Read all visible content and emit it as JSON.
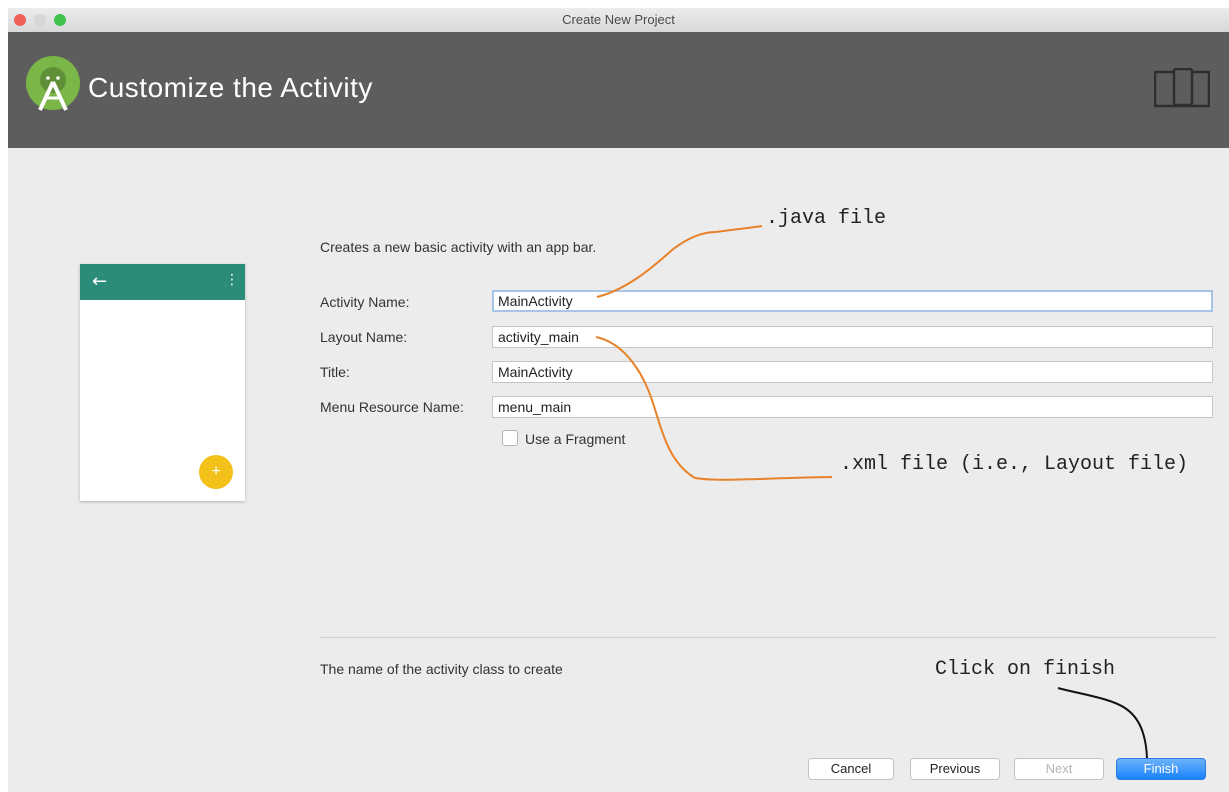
{
  "window": {
    "title": "Create New Project"
  },
  "header": {
    "title": "Customize the Activity",
    "logo_icon": "android-studio-logo-icon",
    "device_icon": "device-layout-icon"
  },
  "preview": {
    "back_icon": "←",
    "menu_icon": "⋮",
    "fab_icon": "+",
    "bar_color": "#2b8c79",
    "fab_color": "#f3c11a"
  },
  "form": {
    "description": "Creates a new basic activity with an app bar.",
    "activity_name": {
      "label": "Activity Name:",
      "value": "MainActivity"
    },
    "layout_name": {
      "label": "Layout Name:",
      "value": "activity_main"
    },
    "title": {
      "label": "Title:",
      "value": "MainActivity"
    },
    "menu_resource_name": {
      "label": "Menu Resource Name:",
      "value": "menu_main"
    },
    "use_fragment": {
      "label": "Use a Fragment",
      "checked": false
    }
  },
  "hint": "The name of the activity class to create",
  "buttons": {
    "cancel": "Cancel",
    "previous": "Previous",
    "next": "Next",
    "finish": "Finish"
  },
  "annotations": {
    "java_file": ".java file",
    "xml_file": ".xml file (i.e., Layout file)",
    "click_finish": "Click on finish",
    "arrow_color": "#e8822a"
  }
}
